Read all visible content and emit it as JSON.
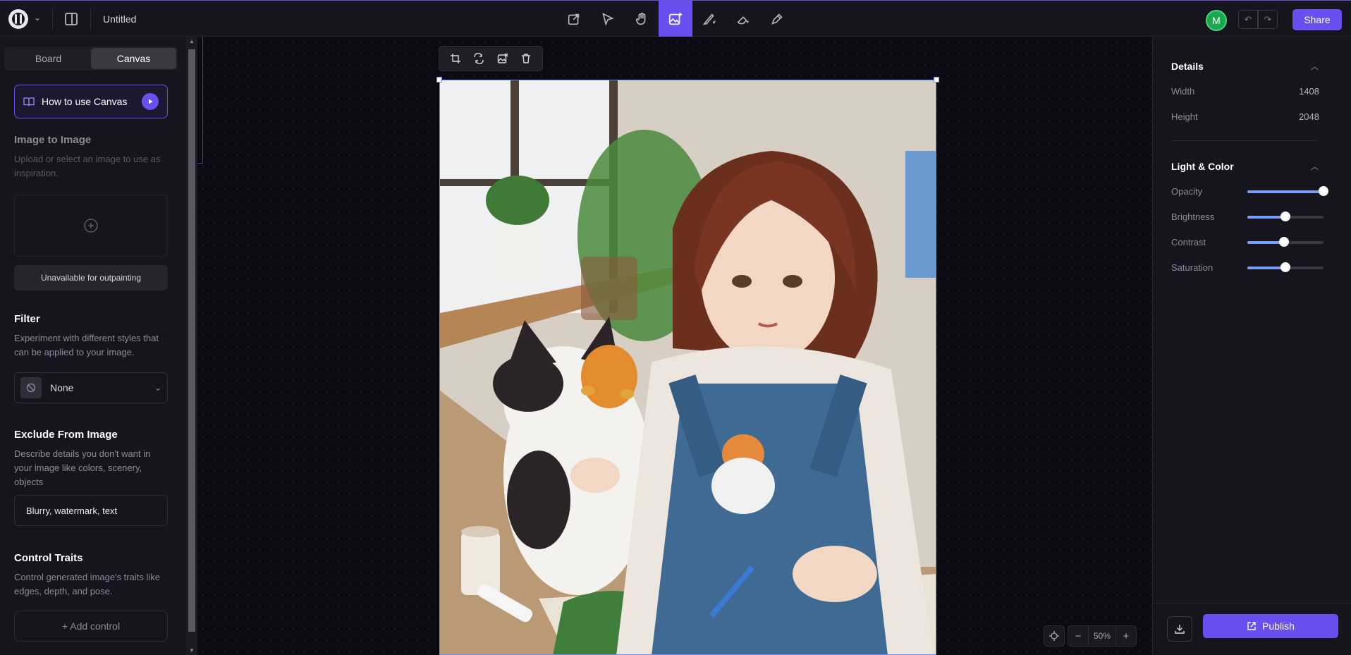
{
  "header": {
    "doc_title": "Untitled",
    "avatar_initial": "M",
    "share_label": "Share",
    "tools": [
      "import-icon",
      "select-icon",
      "hand-icon",
      "image-generate-icon",
      "brush-icon",
      "eraser-icon",
      "pen-icon"
    ],
    "active_tool": "image-generate-icon"
  },
  "sidebar": {
    "tabs": [
      "Board",
      "Canvas"
    ],
    "active_tab": "Canvas",
    "howto_label": "How to use Canvas",
    "image_to_image": {
      "title": "Image to Image",
      "desc": "Upload or select an image to use as inspiration.",
      "unavailable": "Unavailable for outpainting"
    },
    "filter": {
      "title": "Filter",
      "desc": "Experiment with different styles that can be applied to your image.",
      "value": "None"
    },
    "exclude": {
      "title": "Exclude From Image",
      "desc": "Describe details you don't want in your image like colors, scenery, objects",
      "value": "Blurry, watermark, text"
    },
    "control": {
      "title": "Control Traits",
      "desc": "Control generated image's traits like edges, depth, and pose.",
      "add_label": "+ Add control"
    }
  },
  "canvas": {
    "image_toolbar": [
      "crop-icon",
      "swap-icon",
      "replace-image-icon",
      "trash-icon"
    ],
    "zoom": "50%"
  },
  "details": {
    "title": "Details",
    "width_label": "Width",
    "width_value": "1408",
    "height_label": "Height",
    "height_value": "2048"
  },
  "light_color": {
    "title": "Light & Color",
    "sliders": [
      {
        "label": "Opacity",
        "value": 1.0
      },
      {
        "label": "Brightness",
        "value": 0.5
      },
      {
        "label": "Contrast",
        "value": 0.48
      },
      {
        "label": "Saturation",
        "value": 0.5
      }
    ]
  },
  "footer": {
    "publish_label": "Publish"
  },
  "colors": {
    "accent": "#6a4ff0",
    "slider": "#7a9cff",
    "avatar": "#1aa84f"
  }
}
